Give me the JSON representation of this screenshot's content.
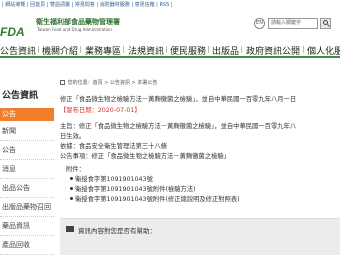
{
  "toplinks": "| 網站導覽 | 回首頁 | 雙語詞彙 | 常見問答 | 消防器材服務 | 意見信箱 | RSS |",
  "header": {
    "logo_text": "FDA",
    "org_name": "衛生福利部食品藥物管理署",
    "org_en": "Taiwan Food and Drug Administration",
    "lang": "EN",
    "search_placeholder": "請輸入關鍵字"
  },
  "nav": [
    "公告資訊",
    "機關介紹",
    "業務專區",
    "法規資訊",
    "便民服務",
    "出版品",
    "政府資訊公開",
    "個人化服務"
  ],
  "breadcrumb": "您的位置：首頁 > 公告資訊 > 本署公告",
  "sidebar": {
    "title": "公告資訊",
    "active": "公告",
    "items": [
      "新聞",
      "公告",
      "消息",
      "出品公告",
      "出版品藥物召回",
      "藥品資訊",
      "產品回收",
      "保健品廣告專"
    ]
  },
  "content": {
    "line1": "修正「食品微生物之檢驗方法－黃麴黴菌之檢驗」，並自中華民國一百零九年八月一日",
    "line2_red": "【發布日期：2020-07-01】",
    "line3": "主旨：修正「食品微生物之檢驗方法－黃麴黴菌之檢驗」，並自中華民國一百零九年八",
    "line4": "日生效。",
    "line5": "依據：食品安全衛生管理法第三十八條",
    "line6": "公告事項：修正「食品微生物之檢驗方法－黃麴黴菌之檢驗」",
    "attach_title": "附件：",
    "attachments": [
      "衛授食字第1091901043號",
      "衛授食字第1091901043號附件(檢驗方法)",
      "衛授食字第1091901043號附件(修正總說明及修正對照表)"
    ]
  },
  "feedback": {
    "prompt": "資訊內容對您是否有幫助："
  },
  "colors": {
    "accent_green": "#3f8f3f",
    "sidebar_active": "#f07f2d",
    "date_red": "#d4342c"
  }
}
